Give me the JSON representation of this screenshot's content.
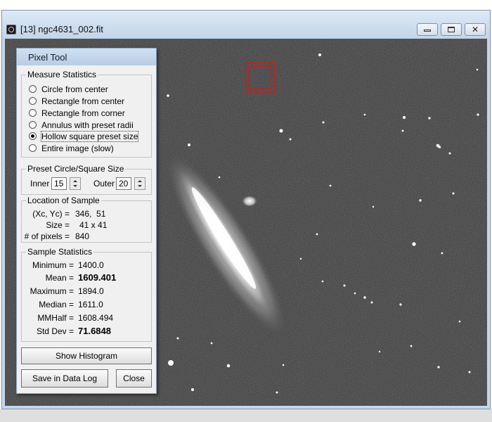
{
  "window": {
    "title": "[13] ngc4631_002.fit",
    "controls": {
      "minimize": "minimize-icon",
      "maximize": "maximize-icon",
      "close": "✕"
    }
  },
  "pixel_tool": {
    "title": "Pixel Tool",
    "measure_statistics": {
      "label": "Measure Statistics",
      "options": [
        {
          "label": "Circle from center",
          "checked": false
        },
        {
          "label": "Rectangle from center",
          "checked": false
        },
        {
          "label": "Rectangle from corner",
          "checked": false
        },
        {
          "label": "Annulus with preset radii",
          "checked": false
        },
        {
          "label": "Hollow square preset size",
          "checked": true
        },
        {
          "label": "Entire image (slow)",
          "checked": false
        }
      ]
    },
    "preset_size": {
      "label": "Preset Circle/Square Size",
      "inner_label": "Inner",
      "inner_value": "15",
      "outer_label": "Outer",
      "outer_value": "20"
    },
    "location": {
      "label": "Location of Sample",
      "rows": [
        {
          "label": "(Xc, Yc) =",
          "value": "346,  51"
        },
        {
          "label": "Size =",
          "value": "41 x 41"
        },
        {
          "label": "# of pixels =",
          "value": "840"
        }
      ]
    },
    "sample_statistics": {
      "label": "Sample Statistics",
      "rows": [
        {
          "label": "Minimum =",
          "value": "1400.0",
          "bold": false
        },
        {
          "label": "Mean =",
          "value": "1609.401",
          "bold": true
        },
        {
          "label": "Maximum =",
          "value": "1894.0",
          "bold": false
        },
        {
          "label": "Median =",
          "value": "1611.0",
          "bold": false
        },
        {
          "label": "MMHalf =",
          "value": "1608.494",
          "bold": false
        },
        {
          "label": "Std Dev =",
          "value": "71.6848",
          "bold": true
        }
      ]
    },
    "buttons": {
      "show_histogram": "Show Histogram",
      "save_in_data_log": "Save in Data Log",
      "close": "Close"
    }
  },
  "colors": {
    "sky": "#3b3b3b",
    "selection": "#d21a1a",
    "window_frame": "#c6d7ea"
  }
}
